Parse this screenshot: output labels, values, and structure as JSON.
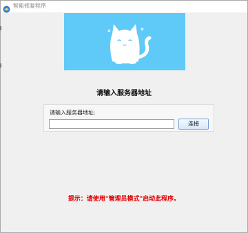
{
  "window": {
    "title": "智能修复程序"
  },
  "banner": {
    "background_color": "#5fcaf7",
    "illustration": "white-cat-icon"
  },
  "main": {
    "prompt_title": "请输入服务器地址",
    "field_label": "请输入服务器地址:",
    "server_input": {
      "value": "",
      "placeholder": ""
    },
    "connect_label": "连接",
    "hint": "提示：请使用\"管理员模式\"启动此程序。",
    "hint_color": "#e60000"
  }
}
